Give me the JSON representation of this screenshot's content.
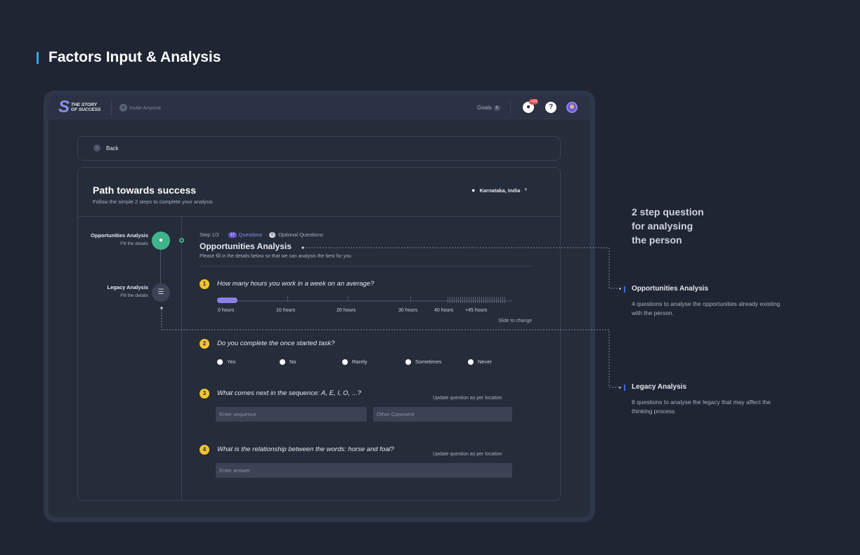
{
  "page": {
    "title": "Factors Input  & Analysis"
  },
  "topbar": {
    "logo_lines": [
      "THE STORY",
      "OF SUCCESS"
    ],
    "invite_label": "Invite Anyone",
    "goals_label": "Goals",
    "goals_count": "5",
    "notifications_badge": "+99",
    "help_label": "?"
  },
  "back": {
    "label": "Back"
  },
  "card": {
    "title": "Path towards success",
    "subtitle": "Follow the simple 2 steps to complete your analysis",
    "location": "Karnataka, India"
  },
  "steps": [
    {
      "title": "Opportunities Analysis",
      "subtitle": "Fill the details"
    },
    {
      "title": "Legacy Analysis",
      "subtitle": "Fill the details"
    }
  ],
  "section": {
    "step_label": "Step 1/2",
    "questions_count": "17",
    "questions_label": "Questions",
    "optional_count": "6",
    "optional_label": "Optional Questions",
    "title": "Opportunities Analysis",
    "subtitle": "Please fill in the details below so that we can analysis the best for you"
  },
  "questions": [
    {
      "number": "1",
      "text": "How many hours you work in a week on an average?"
    },
    {
      "number": "2",
      "text": "Do you complete the once started task?"
    },
    {
      "number": "3",
      "text": "What comes next in the sequence: A, E, I, O, ...?"
    },
    {
      "number": "4",
      "text": "What is the relationship between the words: horse and foal?"
    }
  ],
  "slider": {
    "labels": [
      "0 hours",
      "10 hours",
      "20 hours",
      "30 hours",
      "40 hours",
      "+45 hours"
    ],
    "hint": "Slide to change",
    "value_fraction": 0.07
  },
  "radio_options": [
    "Yes",
    "No",
    "Rarely",
    "Sometimes",
    "Never"
  ],
  "update_note": "Update question as per location",
  "inputs": {
    "sequence_placeholder": "Enter sequence",
    "comment_placeholder": "Other Comment",
    "answer_placeholder": "Enter answer"
  },
  "annotations": {
    "title": "2 step question\nfor analysing\nthe person",
    "opportunities": {
      "title": "Opportunities Analysis",
      "body": "4 questions to analyse the opportunities already existing with the person."
    },
    "legacy": {
      "title": "Legacy Analysis",
      "body": "8  questions to analyse the legacy that may affect the thinking process"
    }
  },
  "colors": {
    "background": "#1f2533",
    "accent_green": "#3fb48a",
    "accent_purple": "#8b80e8",
    "question_badge": "#f4c430",
    "title_bar": "#3aa7e6"
  }
}
